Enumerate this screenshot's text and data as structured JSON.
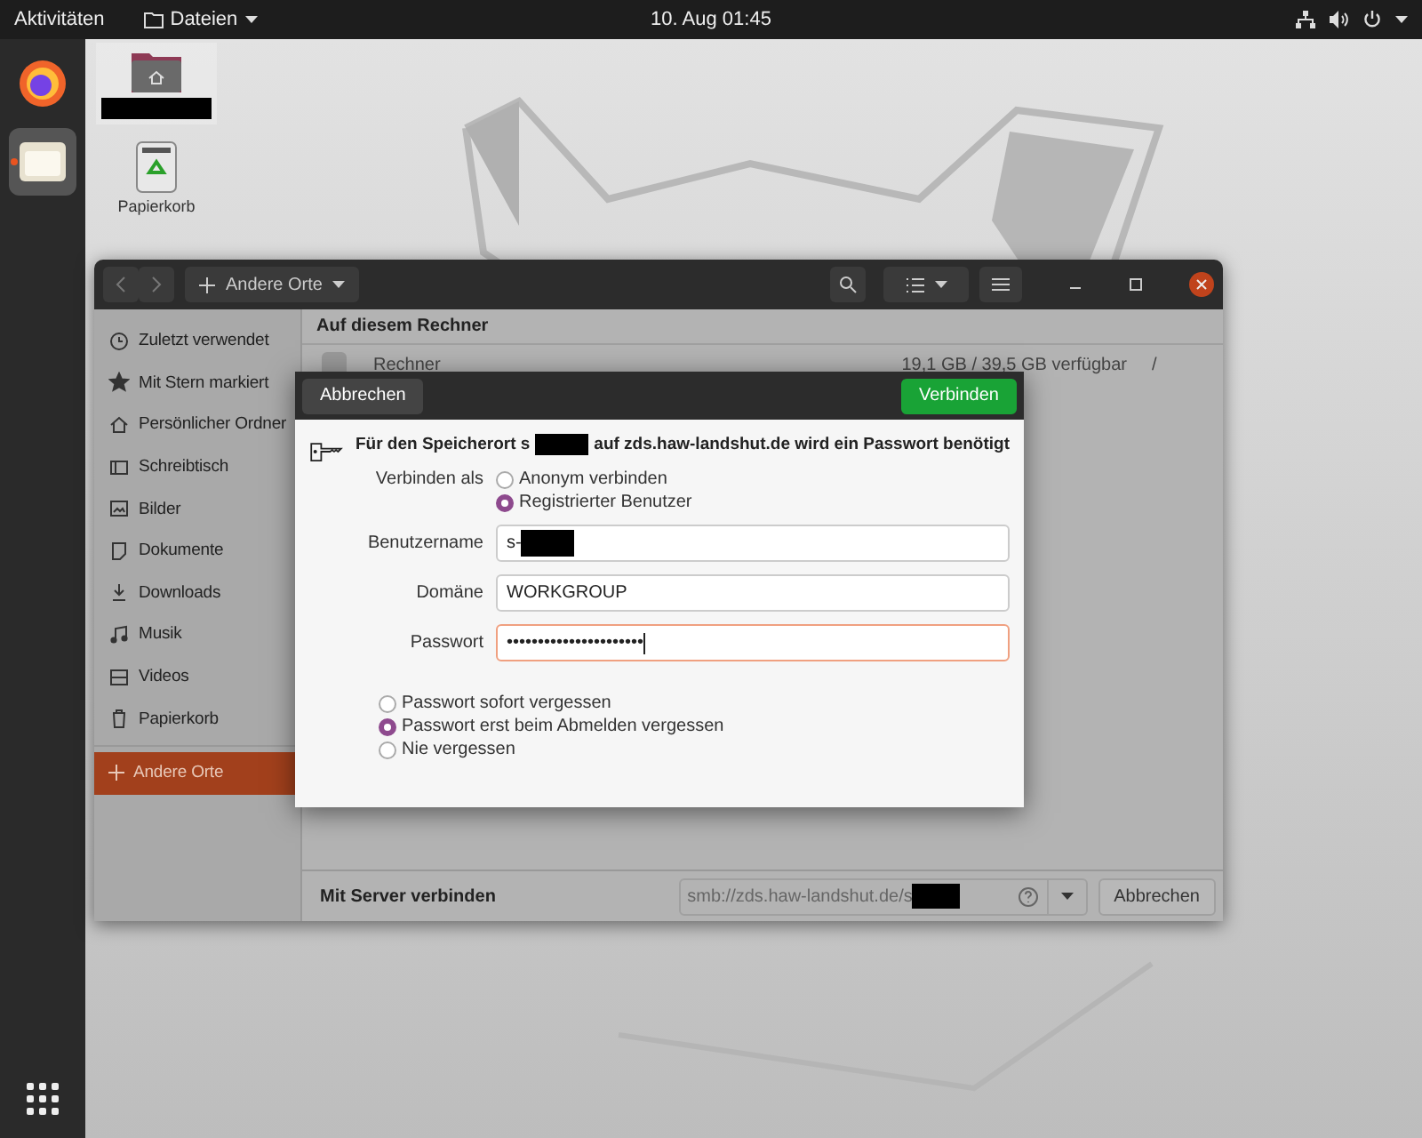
{
  "top_bar": {
    "activities": "Aktivitäten",
    "app_menu": "Dateien",
    "clock": "10. Aug  01:45"
  },
  "dock": [
    {
      "kind": "firefox",
      "selected": false,
      "running": false
    },
    {
      "kind": "files",
      "selected": true,
      "running": true
    }
  ],
  "desktop_icons": [
    {
      "kind": "home",
      "redacted": true
    },
    {
      "kind": "trash",
      "label": "Papierkorb",
      "redacted": false
    }
  ],
  "files_window": {
    "path": "Andere Orte",
    "sidebar": [
      {
        "label": "Zuletzt verwendet",
        "selected": false
      },
      {
        "label": "Mit Stern markiert",
        "selected": false
      },
      {
        "label": "Persönlicher Ordner",
        "selected": false
      },
      {
        "label": "Schreibtisch",
        "selected": false
      },
      {
        "label": "Bilder",
        "selected": false
      },
      {
        "label": "Dokumente",
        "selected": false
      },
      {
        "label": "Downloads",
        "selected": false
      },
      {
        "label": "Musik",
        "selected": false
      },
      {
        "label": "Videos",
        "selected": false
      },
      {
        "label": "Papierkorb",
        "selected": false
      },
      {
        "label": "Andere Orte",
        "selected": true
      }
    ],
    "section_title": "Auf diesem Rechner",
    "rows": [
      {
        "name": "Rechner",
        "space": "19,1 GB / 39,5 GB verfügbar",
        "mount": "/"
      }
    ],
    "connect_bar": {
      "label": "Mit Server verbinden",
      "address": "smb://zds.haw-landshut.de/s",
      "address_redacted": true,
      "button": "Abbrechen"
    }
  },
  "dialog": {
    "cancel": "Abbrechen",
    "confirm": "Verbinden",
    "message_before": "Für den Speicherort s",
    "message_redacted": true,
    "message_after": "auf zds.haw-landshut.de wird ein Passwort benötigt",
    "connect_as_label": "Verbinden als",
    "connect_as": [
      {
        "label": "Anonym verbinden",
        "selected": false
      },
      {
        "label": "Registrierter Benutzer",
        "selected": true
      }
    ],
    "fields": [
      {
        "label": "Benutzername",
        "value": "s-",
        "redacted": true,
        "focused": false
      },
      {
        "label": "Domäne",
        "value": "WORKGROUP",
        "redacted": false,
        "focused": false
      },
      {
        "label": "Passwort",
        "value": "••••••••••••••••••••••",
        "redacted": false,
        "focused": true
      }
    ],
    "remember": [
      {
        "label": "Passwort sofort vergessen",
        "selected": false
      },
      {
        "label": "Passwort erst beim Abmelden vergessen",
        "selected": true
      },
      {
        "label": "Nie vergessen",
        "selected": false
      }
    ]
  }
}
